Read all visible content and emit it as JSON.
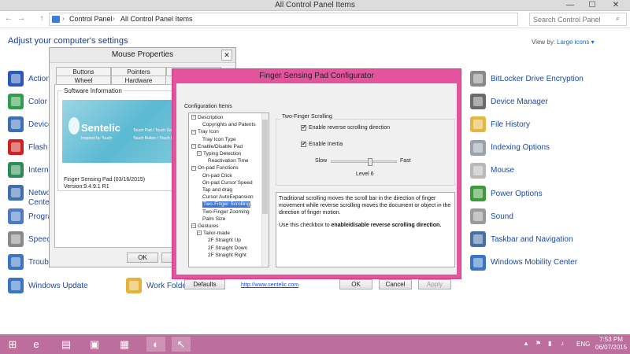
{
  "window": {
    "title": "All Control Panel Items",
    "minimize": "—",
    "maximize": "☐",
    "close": "✕"
  },
  "toolbar": {
    "back": "←",
    "forward": "→",
    "up": "↑",
    "breadcrumbs": [
      "Control Panel",
      "All Control Panel Items"
    ],
    "search_placeholder": "Search Control Panel"
  },
  "control_panel": {
    "heading": "Adjust your computer's settings",
    "view_by_label": "View by:",
    "view_by_value": "Large icons ▾",
    "left_items": [
      {
        "label": "Action",
        "icon": "flag-icon",
        "color": "#2a58b8"
      },
      {
        "label": "Color",
        "icon": "color-icon",
        "color": "#2f9d4b"
      },
      {
        "label": "Device",
        "icon": "device-icon",
        "color": "#3b6fb6"
      },
      {
        "label": "Flash",
        "icon": "flash-icon",
        "color": "#cc2222"
      },
      {
        "label": "Intern",
        "icon": "globe-icon",
        "color": "#2e8b57"
      },
      {
        "label": "Netwo",
        "icon": "network-icon",
        "color": "#3f6fb0"
      },
      {
        "label": "Cente",
        "icon": "",
        "color": ""
      },
      {
        "label": "Progra",
        "icon": "programs-icon",
        "color": "#4a7bc4"
      },
      {
        "label": "Speec",
        "icon": "microphone-icon",
        "color": "#8a8a8a"
      },
      {
        "label": "Troub",
        "icon": "troubleshoot-icon",
        "color": "#3a75c4"
      },
      {
        "label": "Windows Update",
        "icon": "windows-update-icon",
        "color": "#3a75c4"
      }
    ],
    "middle_item": {
      "label": "Work Folders",
      "icon": "work-folders-icon",
      "color": "#e6b33a"
    },
    "right_items": [
      {
        "label": "BitLocker Drive Encryption",
        "icon": "bitlocker-icon",
        "color": "#8a8a8a"
      },
      {
        "label": "Device Manager",
        "icon": "device-manager-icon",
        "color": "#6a6a6a"
      },
      {
        "label": "File History",
        "icon": "file-history-icon",
        "color": "#e3b640"
      },
      {
        "label": "Indexing Options",
        "icon": "indexing-icon",
        "color": "#9aa3ad"
      },
      {
        "label": "Mouse",
        "icon": "mouse-icon",
        "color": "#b9b9b9"
      },
      {
        "label": "Power Options",
        "icon": "power-icon",
        "color": "#3d9b3d"
      },
      {
        "label": "Sound",
        "icon": "sound-icon",
        "color": "#9a9a9a"
      },
      {
        "label": "Taskbar and Navigation",
        "icon": "taskbar-icon",
        "color": "#4a6fa5"
      },
      {
        "label": "Windows Mobility Center",
        "icon": "mobility-icon",
        "color": "#3a75c4"
      }
    ]
  },
  "mouse_dialog": {
    "title": "Mouse Properties",
    "close": "✕",
    "tabs_top": [
      "Buttons",
      "Pointers",
      ""
    ],
    "tabs_bottom": [
      "Wheel",
      "Hardware"
    ],
    "group_label": "Software Information",
    "banner_logo": "Sentelic",
    "banner_sub": "Inspired by Touch",
    "banner_tag1": "Touch Pad / Touch Screen",
    "banner_tag2": "Touch Button / Touch Panel",
    "info_line1": "Finger Sensing Pad (03/16/2015)",
    "info_line2": "Version:9.4.9.1 R1",
    "ok_label": "OK",
    "cancel_label": "C"
  },
  "fsp_dialog": {
    "title": "Finger Sensing Pad Configurator",
    "config_label": "Configuration Items",
    "tree": [
      {
        "label": "Description",
        "toggle": "⊟",
        "indent": 0
      },
      {
        "label": "Copyrights and Patents",
        "toggle": "",
        "indent": 2
      },
      {
        "label": "Tray Icon",
        "toggle": "⊟",
        "indent": 0
      },
      {
        "label": "Tray Icon Type",
        "toggle": "",
        "indent": 2
      },
      {
        "label": "Enable/Disable Pad",
        "toggle": "⊟",
        "indent": 0
      },
      {
        "label": "Typing Detection",
        "toggle": "⊟",
        "indent": 1
      },
      {
        "label": "Reactivation Time",
        "toggle": "",
        "indent": 3
      },
      {
        "label": "On-pad Functions",
        "toggle": "⊟",
        "indent": 0
      },
      {
        "label": "On-pad Click",
        "toggle": "",
        "indent": 2
      },
      {
        "label": "On-pad Cursor Speed",
        "toggle": "",
        "indent": 2
      },
      {
        "label": "Tap and drag",
        "toggle": "",
        "indent": 2
      },
      {
        "label": "Cursor AutoExpansion",
        "toggle": "",
        "indent": 2
      },
      {
        "label": "Two-Finger Scrolling",
        "toggle": "",
        "indent": 2,
        "selected": true
      },
      {
        "label": "Two-Finger Zooming",
        "toggle": "",
        "indent": 2
      },
      {
        "label": "Palm Size",
        "toggle": "",
        "indent": 2
      },
      {
        "label": "Gestures",
        "toggle": "⊟",
        "indent": 0
      },
      {
        "label": "Tailor-made",
        "toggle": "⊟",
        "indent": 1
      },
      {
        "label": "2F Straight Up",
        "toggle": "",
        "indent": 3
      },
      {
        "label": "2F Straight Down",
        "toggle": "",
        "indent": 3
      },
      {
        "label": "2F Straight Right",
        "toggle": "",
        "indent": 3
      }
    ],
    "section_label": "Two-Finger Scrolling",
    "checkbox1_label": "Enable reverse scrolling direction",
    "checkbox1_mark": "✔",
    "checkbox2_label": "Enable Inertia",
    "checkbox2_mark": "✔",
    "slow_label": "Slow",
    "fast_label": "Fast",
    "level_label": "Level 6",
    "speed_level": 6,
    "speed_max": 10,
    "desc_para1": "Traditional scrolling moves the scroll bar in the direction of finger movement while reverse scrolling moves the document or object in the direction of finger motion.",
    "desc_para2_prefix": "Use this checkbox to ",
    "desc_para2_bold": "enable/disable reverse scrolling direction.",
    "defaults_label": "Defaults",
    "url": "http://www.sentelic.com",
    "ok_label": "OK",
    "cancel_label": "Cancel",
    "apply_label": "Apply",
    "accent": "#e4549e"
  },
  "taskbar": {
    "start": "⊞",
    "apps": [
      {
        "glyph": "e",
        "name": "internet-explorer-icon"
      },
      {
        "glyph": "▤",
        "name": "file-explorer-icon"
      },
      {
        "glyph": "▣",
        "name": "store-icon"
      },
      {
        "glyph": "▦",
        "name": "control-panel-icon"
      },
      {
        "glyph": "◐",
        "name": "mouse-app-icon"
      },
      {
        "glyph": "↖",
        "name": "fsp-app-icon"
      }
    ],
    "lang": "ENG",
    "time": "7:53 PM",
    "date": "06/07/2015",
    "accent": "#bc6e9c"
  }
}
